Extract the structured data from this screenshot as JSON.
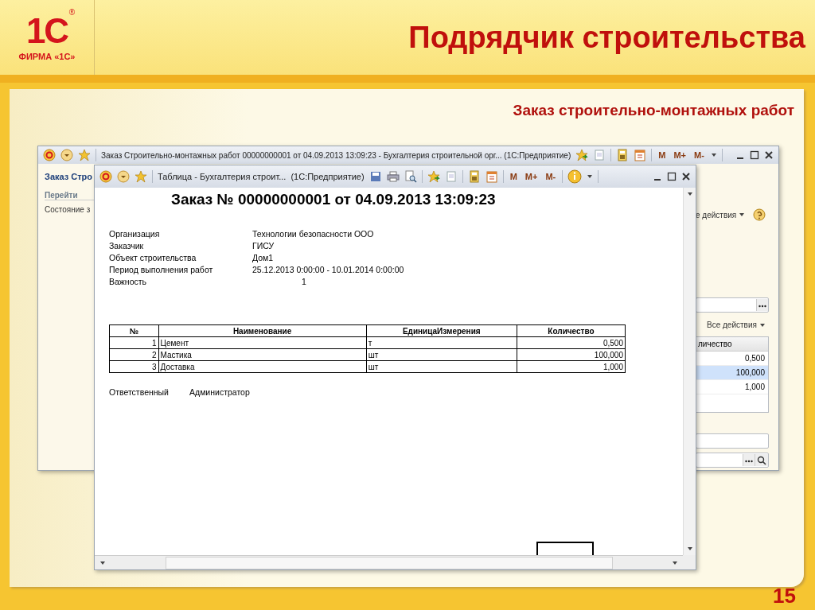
{
  "header": {
    "logo_mark": "1С",
    "logo_registered": "®",
    "logo_caption": "ФИРМА «1С»",
    "title": "Подрядчик строительства"
  },
  "subtitle": "Заказ строительно-монтажных работ",
  "page_number": "15",
  "back_window": {
    "title": "Заказ Строительно-монтажных работ 00000000001 от 04.09.2013 13:09:23 - Бухгалтерия строительной орг... (1С:Предприятие)",
    "memory_buttons": [
      "M",
      "M+",
      "M-"
    ],
    "form_title": "Заказ Стро",
    "nav_heading": "Перейти",
    "nav_items": [
      "Состояние з"
    ],
    "actions_menu": "е действия",
    "all_actions_menu": "Все действия",
    "grid_header": "личество",
    "grid_rows": [
      {
        "value": "0,500",
        "selected": false
      },
      {
        "value": "100,000",
        "selected": true
      },
      {
        "value": "1,000",
        "selected": false
      }
    ]
  },
  "front_window": {
    "title": "Таблица - Бухгалтерия строит...",
    "app_name": "(1С:Предприятие)",
    "memory_buttons": [
      "M",
      "M+",
      "M-"
    ],
    "document": {
      "heading": "Заказ № 00000000001 от 04.09.2013 13:09:23",
      "fields": [
        {
          "label": "Организация",
          "value": "Технологии безопасности ООО"
        },
        {
          "label": "Заказчик",
          "value": "ГИСУ"
        },
        {
          "label": "Объект строительства",
          "value": "Дом1"
        },
        {
          "label": "Период выполнения работ",
          "value": "25.12.2013 0:00:00 - 10.01.2014 0:00:00"
        },
        {
          "label": "Важность",
          "value": "1"
        }
      ],
      "table": {
        "columns": [
          "№",
          "Наименование",
          "ЕдиницаИзмерения",
          "Количество"
        ],
        "rows": [
          [
            "1",
            "Цемент",
            "т",
            "0,500"
          ],
          [
            "2",
            "Мастика",
            "шт",
            "100,000"
          ],
          [
            "3",
            "Доставка",
            "шт",
            "1,000"
          ]
        ]
      },
      "responsible_label": "Ответственный",
      "responsible_value": "Администратор"
    }
  }
}
